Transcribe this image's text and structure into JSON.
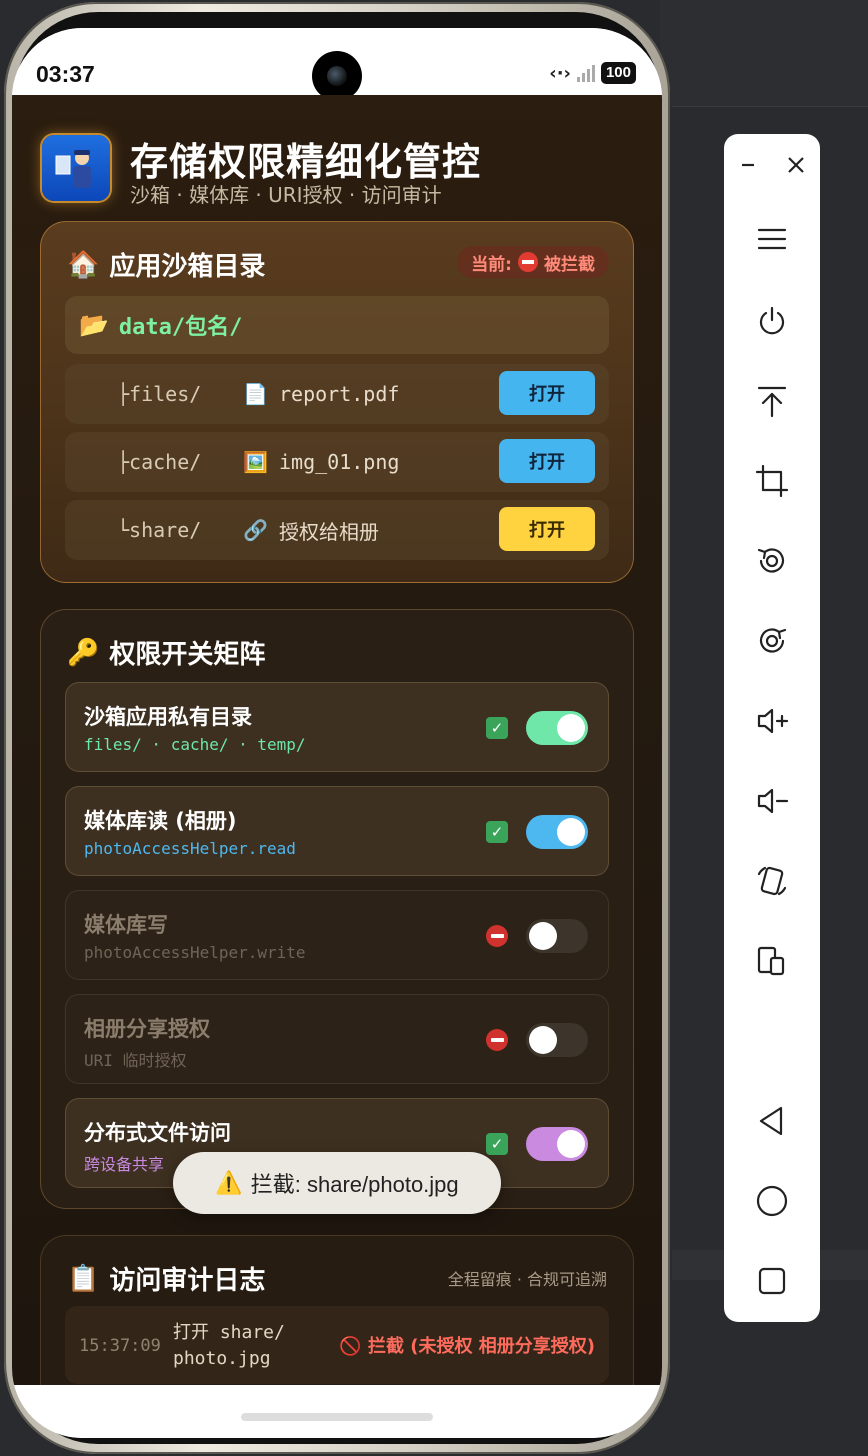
{
  "status": {
    "time": "03:37",
    "battery": "100"
  },
  "header": {
    "title": "存储权限精细化管控",
    "subtitle": "沙箱 · 媒体库 · URI授权 · 访问审计"
  },
  "sandbox": {
    "title": "应用沙箱目录",
    "badge_prefix": "当前:",
    "badge_status": "被拦截",
    "root": "data/包名/",
    "rows": [
      {
        "dir": "├files/",
        "file": "report.pdf",
        "button": "打开"
      },
      {
        "dir": "├cache/",
        "file": "img_01.png",
        "button": "打开"
      },
      {
        "dir": "└share/",
        "file": "授权给相册",
        "button": "打开"
      }
    ]
  },
  "permissions": {
    "title": "权限开关矩阵",
    "items": [
      {
        "name": "沙箱应用私有目录",
        "sub": "files/ · cache/ · temp/",
        "enabled": true,
        "color": "#6ee7a8",
        "sub_color": "#6ee7a8"
      },
      {
        "name": "媒体库读 (相册)",
        "sub": "photoAccessHelper.read",
        "enabled": true,
        "color": "#4db8ef",
        "sub_color": "#4db8ef"
      },
      {
        "name": "媒体库写",
        "sub": "photoAccessHelper.write",
        "enabled": false,
        "color": "#3d352c",
        "sub_color": "#6f6455"
      },
      {
        "name": "相册分享授权",
        "sub": "URI 临时授权",
        "enabled": false,
        "color": "#3d352c",
        "sub_color": "#6f6455"
      },
      {
        "name": "分布式文件访问",
        "sub": "跨设备共享",
        "enabled": true,
        "color": "#c98ae0",
        "sub_color": "#c98ae0"
      }
    ]
  },
  "toast": {
    "text": "拦截: share/photo.jpg"
  },
  "audit": {
    "title": "访问审计日志",
    "meta": "全程留痕 · 合规可追溯",
    "entries": [
      {
        "time": "15:37:09",
        "action": "打开 share/ photo.jpg",
        "result": "拦截 (未授权 相册分享授权)"
      }
    ]
  },
  "toolbar": {
    "buttons": [
      "minimize",
      "close",
      "menu",
      "power",
      "upload",
      "crop",
      "rotate-left",
      "rotate-right",
      "volume-up",
      "volume-down",
      "rotate-device",
      "device-switch",
      "back",
      "home",
      "recents"
    ]
  }
}
